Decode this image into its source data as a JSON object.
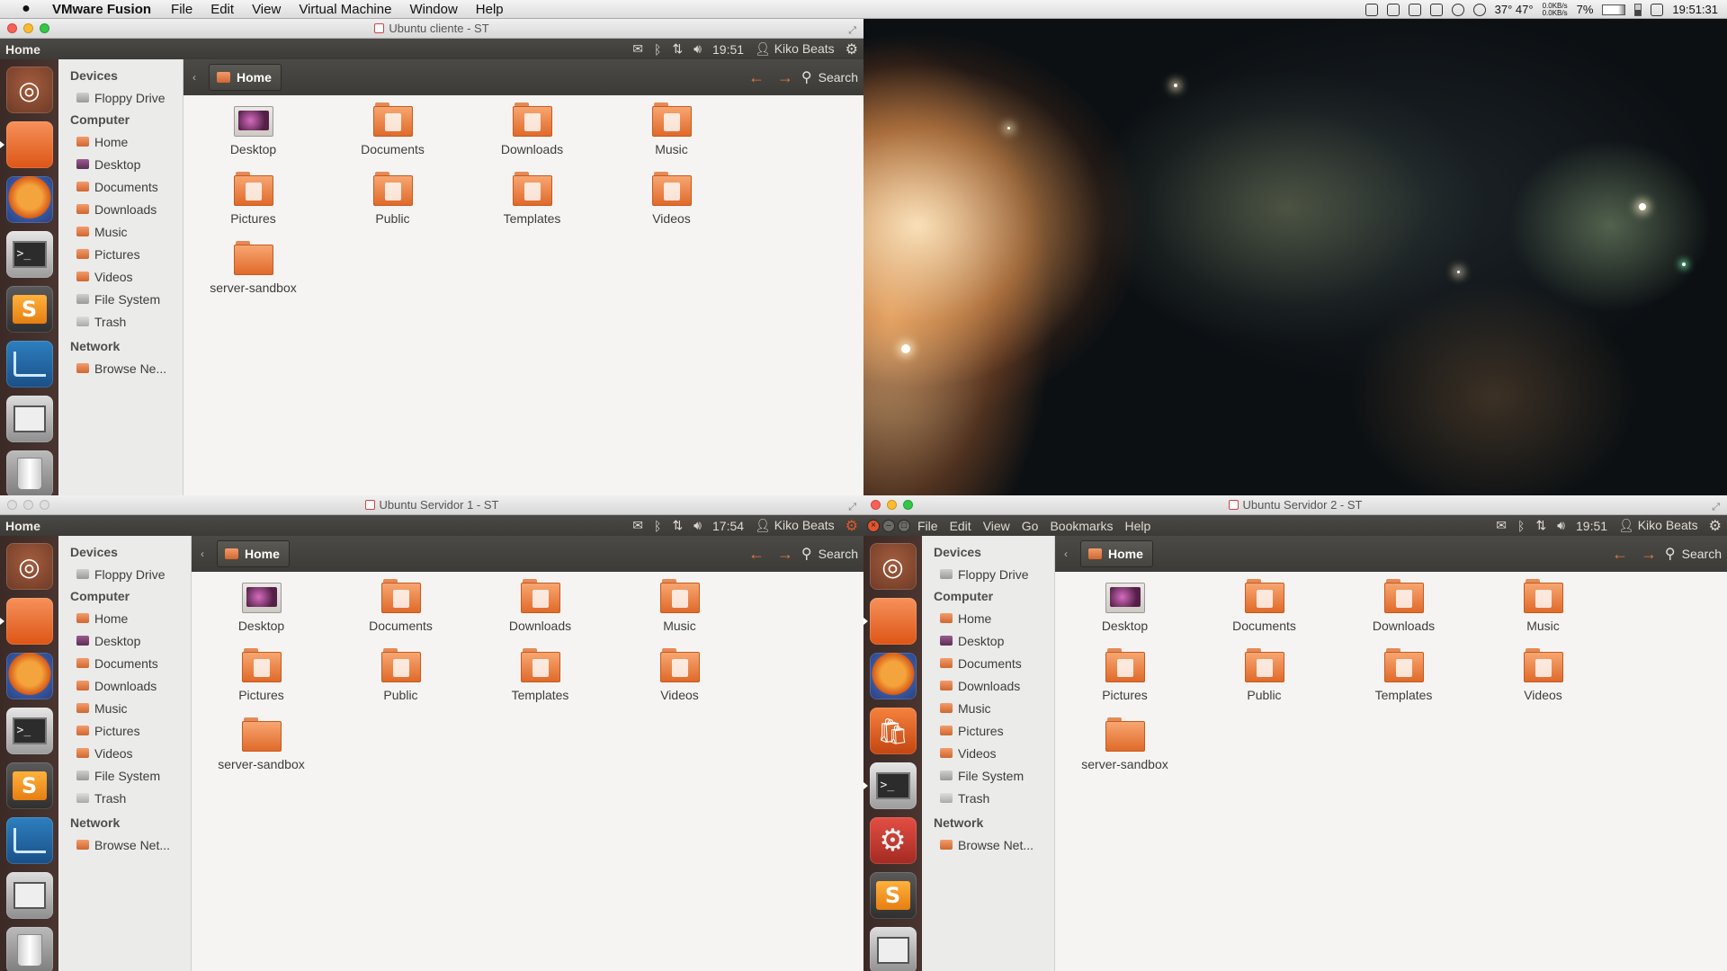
{
  "mac": {
    "apple": "",
    "app": "VMware Fusion",
    "menus": [
      "File",
      "Edit",
      "View",
      "Virtual Machine",
      "Window",
      "Help"
    ],
    "temp": "37° 47°",
    "net_up": "0.0KB/s",
    "net_down": "0.0KB/s",
    "cpu": "7%",
    "clock": "19:51:31"
  },
  "win1": {
    "title": "Ubuntu cliente - ST",
    "panel_title": "Home",
    "time": "19:51",
    "user": "Kiko Beats"
  },
  "win2": {
    "title": "Ubuntu Servidor 1 - ST",
    "panel_title": "Home",
    "time": "17:54",
    "user": "Kiko Beats"
  },
  "win3": {
    "title": "Ubuntu Servidor 2 - ST",
    "menus": [
      "File",
      "Edit",
      "View",
      "Go",
      "Bookmarks",
      "Help"
    ],
    "time": "19:51",
    "user": "Kiko Beats"
  },
  "nautilus": {
    "crumb": "Home",
    "search": "Search",
    "sidebar": {
      "devices": "Devices",
      "floppy": "Floppy Drive",
      "computer": "Computer",
      "home": "Home",
      "desktop": "Desktop",
      "documents": "Documents",
      "downloads": "Downloads",
      "music": "Music",
      "pictures": "Pictures",
      "videos": "Videos",
      "filesystem": "File System",
      "trash": "Trash",
      "network": "Network",
      "browse1": "Browse Ne...",
      "browse2": "Browse Net..."
    },
    "files": {
      "desktop": "Desktop",
      "documents": "Documents",
      "downloads": "Downloads",
      "music": "Music",
      "pictures": "Pictures",
      "public": "Public",
      "templates": "Templates",
      "videos": "Videos",
      "sandbox": "server-sandbox"
    }
  }
}
